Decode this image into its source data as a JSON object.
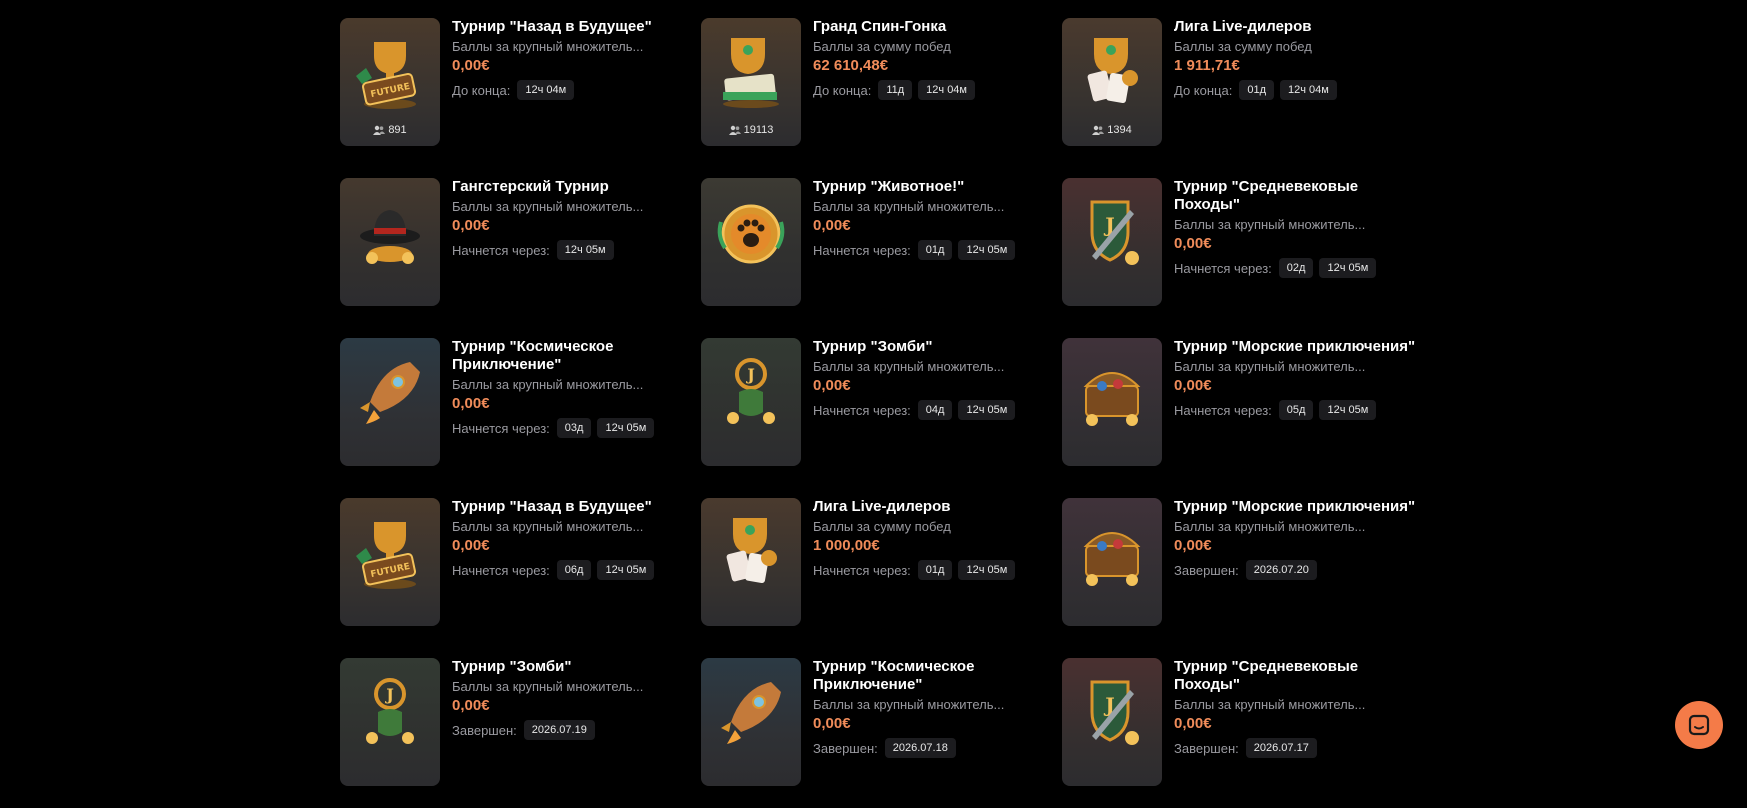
{
  "colors": {
    "background": "#000000",
    "title": "#ffffff",
    "subtitle": "#9a9aa0",
    "amount": "#f08c5a",
    "chip_bg": "#1c1c1f",
    "chat_button": "#f47b48"
  },
  "tournaments": [
    {
      "title": "Турнир \"Назад в Будущее\"",
      "subtitle": "Баллы за крупный множитель...",
      "amount": "0,00€",
      "status_label": "До конца:",
      "chips": [
        "12ч 04м"
      ],
      "players": "891",
      "icon": "future-trophy-icon",
      "tint": [
        "#4a3a2c",
        "#38332f"
      ]
    },
    {
      "title": "Гранд Спин-Гонка",
      "subtitle": "Баллы за сумму побед",
      "amount": "62 610,48€",
      "status_label": "До конца:",
      "chips": [
        "11д",
        "12ч 04м"
      ],
      "players": "19113",
      "icon": "trophy-cash-icon",
      "tint": [
        "#4b3b2c",
        "#38332f"
      ]
    },
    {
      "title": "Лига Live-дилеров",
      "subtitle": "Баллы за сумму побед",
      "amount": "1 911,71€",
      "status_label": "До конца:",
      "chips": [
        "01д",
        "12ч 04м"
      ],
      "players": "1394",
      "icon": "trophy-cards-icon",
      "tint": [
        "#4a3a2e",
        "#38332f"
      ]
    },
    {
      "title": "Гангстерский Турнир",
      "subtitle": "Баллы за крупный множитель...",
      "amount": "0,00€",
      "status_label": "Начнется через:",
      "chips": [
        "12ч 05м"
      ],
      "players": "",
      "icon": "gangster-hat-icon",
      "tint": [
        "#45392e",
        "#33302e"
      ]
    },
    {
      "title": "Турнир \"Животное!\"",
      "subtitle": "Баллы за крупный множитель...",
      "amount": "0,00€",
      "status_label": "Начнется через:",
      "chips": [
        "01д",
        "12ч 05м"
      ],
      "players": "",
      "icon": "paw-medal-icon",
      "tint": [
        "#3c3a33",
        "#30302f"
      ]
    },
    {
      "title": "Турнир \"Средневековые Походы\"",
      "subtitle": "Баллы за крупный множитель...",
      "amount": "0,00€",
      "status_label": "Начнется через:",
      "chips": [
        "02д",
        "12ч 05м"
      ],
      "players": "",
      "icon": "sword-shield-icon",
      "tint": [
        "#4a3030",
        "#352f2f"
      ]
    },
    {
      "title": "Турнир \"Космическое Приключение\"",
      "subtitle": "Баллы за крупный множитель...",
      "amount": "0,00€",
      "status_label": "Начнется через:",
      "chips": [
        "03д",
        "12ч 05м"
      ],
      "players": "",
      "icon": "rocket-icon",
      "tint": [
        "#2c3a44",
        "#2f3135"
      ]
    },
    {
      "title": "Турнир \"Зомби\"",
      "subtitle": "Баллы за крупный множитель...",
      "amount": "0,00€",
      "status_label": "Начнется через:",
      "chips": [
        "04д",
        "12ч 05м"
      ],
      "players": "",
      "icon": "zombie-hand-icon",
      "tint": [
        "#333a33",
        "#2f312f"
      ]
    },
    {
      "title": "Турнир \"Морские приключения\"",
      "subtitle": "Баллы за крупный множитель...",
      "amount": "0,00€",
      "status_label": "Начнется через:",
      "chips": [
        "05д",
        "12ч 05м"
      ],
      "players": "",
      "icon": "treasure-chest-icon",
      "tint": [
        "#40323a",
        "#332f33"
      ]
    },
    {
      "title": "Турнир \"Назад в Будущее\"",
      "subtitle": "Баллы за крупный множитель...",
      "amount": "0,00€",
      "status_label": "Начнется через:",
      "chips": [
        "06д",
        "12ч 05м"
      ],
      "players": "",
      "icon": "future-trophy-icon",
      "tint": [
        "#4a3a2c",
        "#38332f"
      ]
    },
    {
      "title": "Лига Live-дилеров",
      "subtitle": "Баллы за сумму побед",
      "amount": "1 000,00€",
      "status_label": "Начнется через:",
      "chips": [
        "01д",
        "12ч 05м"
      ],
      "players": "",
      "icon": "trophy-cards-icon",
      "tint": [
        "#4a3a2e",
        "#38332f"
      ]
    },
    {
      "title": "Турнир \"Морские приключения\"",
      "subtitle": "Баллы за крупный множитель...",
      "amount": "0,00€",
      "status_label": "Завершен:",
      "chips": [
        "2026.07.20"
      ],
      "players": "",
      "icon": "treasure-chest-icon",
      "tint": [
        "#40323a",
        "#332f33"
      ]
    },
    {
      "title": "Турнир \"Зомби\"",
      "subtitle": "Баллы за крупный множитель...",
      "amount": "0,00€",
      "status_label": "Завершен:",
      "chips": [
        "2026.07.19"
      ],
      "players": "",
      "icon": "zombie-hand-icon",
      "tint": [
        "#333a33",
        "#2f312f"
      ]
    },
    {
      "title": "Турнир \"Космическое Приключение\"",
      "subtitle": "Баллы за крупный множитель...",
      "amount": "0,00€",
      "status_label": "Завершен:",
      "chips": [
        "2026.07.18"
      ],
      "players": "",
      "icon": "rocket-icon",
      "tint": [
        "#2c3a44",
        "#2f3135"
      ]
    },
    {
      "title": "Турнир \"Средневековые Походы\"",
      "subtitle": "Баллы за крупный множитель...",
      "amount": "0,00€",
      "status_label": "Завершен:",
      "chips": [
        "2026.07.17"
      ],
      "players": "",
      "icon": "sword-shield-icon",
      "tint": [
        "#4a3030",
        "#352f2f"
      ]
    }
  ],
  "chat_button": {
    "icon": "chat-icon"
  }
}
